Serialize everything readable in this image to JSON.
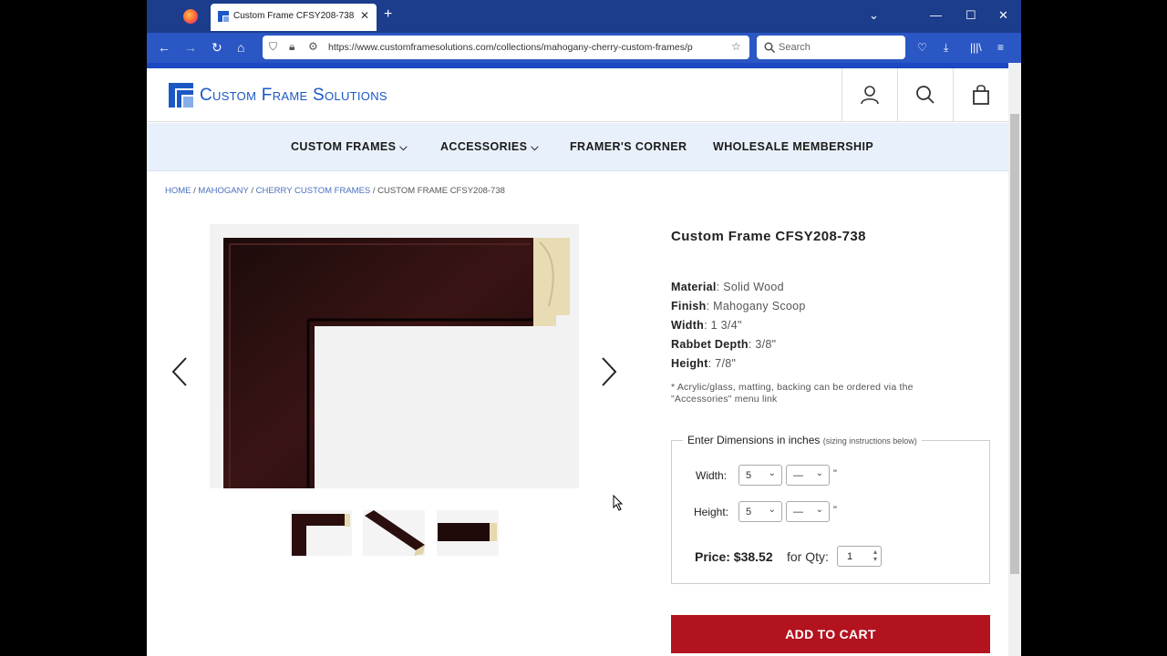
{
  "browser": {
    "tab_title": "Custom Frame CFSY208-738",
    "url": "https://www.customframesolutions.com/collections/mahogany-cherry-custom-frames/p",
    "search_placeholder": "Search"
  },
  "site": {
    "logo_text": "Custom Frame Solutions",
    "menu": [
      "CUSTOM FRAMES",
      "ACCESSORIES",
      "FRAMER'S CORNER",
      "WHOLESALE MEMBERSHIP"
    ],
    "breadcrumb": {
      "home": "HOME",
      "sep": " / ",
      "mahogany": "MAHOGANY",
      "cherry": "CHERRY CUSTOM FRAMES",
      "current": "CUSTOM FRAME CFSY208-738"
    }
  },
  "product": {
    "title": "Custom Frame CFSY208-738",
    "specs": [
      {
        "label": "Material",
        "value": "Solid Wood"
      },
      {
        "label": "Finish",
        "value": "Mahogany Scoop"
      },
      {
        "label": "Width",
        "value": "1 3/4\""
      },
      {
        "label": "Rabbet Depth",
        "value": "3/8\""
      },
      {
        "label": "Height",
        "value": "7/8\""
      }
    ],
    "note": "* Acrylic/glass, matting, backing can be ordered via the \"Accessories\" menu link",
    "dimensions": {
      "legend": "Enter Dimensions in inches",
      "legend_hint": "(sizing instructions below)",
      "width_label": "Width:",
      "height_label": "Height:",
      "width_whole": "5",
      "width_fraction": "—",
      "height_whole": "5",
      "height_fraction": "—",
      "unit_mark": "\""
    },
    "price_label": "Price: $38.52",
    "qty_label": "for Qty:",
    "qty_value": "1",
    "add_to_cart": "ADD TO CART"
  },
  "colors": {
    "brand_blue": "#1a58c4",
    "cart_red": "#b3121f",
    "menu_bg": "#e8f1fb"
  }
}
